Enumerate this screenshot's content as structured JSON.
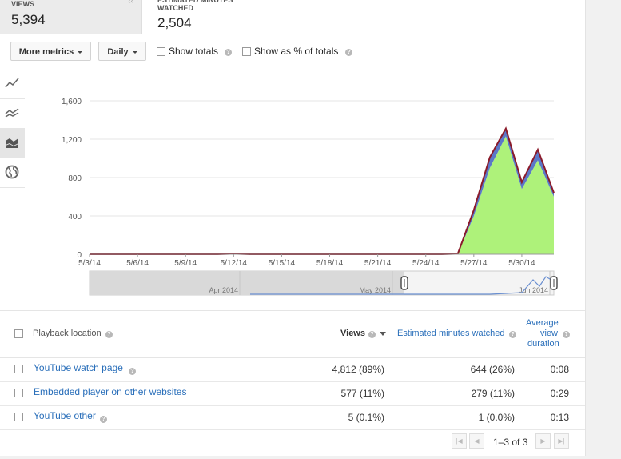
{
  "metrics": [
    {
      "label": "VIEWS",
      "value": "5,394"
    },
    {
      "label": "ESTIMATED MINUTES WATCHED",
      "value": "2,504"
    }
  ],
  "toolbar": {
    "more_metrics": "More metrics",
    "interval": "Daily",
    "show_totals": "Show totals",
    "show_pct": "Show as % of totals"
  },
  "chart_data": {
    "type": "area",
    "x": [
      "5/3/14",
      "5/4/14",
      "5/5/14",
      "5/6/14",
      "5/7/14",
      "5/8/14",
      "5/9/14",
      "5/10/14",
      "5/11/14",
      "5/12/14",
      "5/13/14",
      "5/14/14",
      "5/15/14",
      "5/16/14",
      "5/17/14",
      "5/18/14",
      "5/19/14",
      "5/20/14",
      "5/21/14",
      "5/22/14",
      "5/23/14",
      "5/24/14",
      "5/25/14",
      "5/26/14",
      "5/27/14",
      "5/28/14",
      "5/29/14",
      "5/30/14",
      "5/31/14",
      "6/1/14"
    ],
    "xticks": [
      "5/3/14",
      "5/6/14",
      "5/9/14",
      "5/12/14",
      "5/15/14",
      "5/18/14",
      "5/21/14",
      "5/24/14",
      "5/27/14",
      "5/30/14"
    ],
    "yticks": [
      "0",
      "400",
      "800",
      "1,200",
      "1,600"
    ],
    "ylim": [
      0,
      1600
    ],
    "series": [
      {
        "name": "YouTube watch page",
        "color": "#aef27a",
        "values": [
          0,
          0,
          0,
          0,
          0,
          0,
          0,
          0,
          0,
          0,
          0,
          0,
          0,
          0,
          0,
          0,
          0,
          0,
          0,
          0,
          0,
          0,
          0,
          0,
          400,
          900,
          1230,
          680,
          980,
          600
        ]
      },
      {
        "name": "Embedded player on other websites",
        "color": "#5b78c8",
        "values": [
          0,
          0,
          0,
          0,
          0,
          0,
          0,
          0,
          0,
          5,
          0,
          0,
          0,
          0,
          0,
          0,
          0,
          0,
          0,
          0,
          0,
          0,
          0,
          5,
          60,
          110,
          80,
          70,
          110,
          40
        ]
      },
      {
        "name": "YouTube other",
        "color": "#8b1b2b",
        "values": [
          0,
          0,
          0,
          0,
          0,
          0,
          0,
          0,
          0,
          0,
          0,
          0,
          0,
          0,
          0,
          0,
          0,
          0,
          0,
          0,
          0,
          0,
          0,
          0,
          1,
          1,
          1,
          1,
          1,
          1
        ]
      }
    ],
    "navigator_labels": [
      "Apr 2014",
      "May 2014",
      "Jun 2014"
    ]
  },
  "table": {
    "headers": {
      "location": "Playback location",
      "views": "Views",
      "minutes": "Estimated minutes watched",
      "avg": [
        "Average",
        "view",
        "duration"
      ]
    },
    "rows": [
      {
        "name": "YouTube watch page",
        "views": "4,812 (89%)",
        "minutes": "644 (26%)",
        "avg": "0:08"
      },
      {
        "name": "Embedded player on other websites",
        "views": "577 (11%)",
        "minutes": "279 (11%)",
        "avg": "0:29"
      },
      {
        "name": "YouTube other",
        "views": "5 (0.1%)",
        "minutes": "1 (0.0%)",
        "avg": "0:13"
      }
    ]
  },
  "pager": {
    "range": "1–3 of 3"
  },
  "icons": [
    "line-chart-icon",
    "multi-line-chart-icon",
    "stacked-area-icon",
    "globe-icon",
    "help-icon",
    "sort-desc-icon"
  ]
}
